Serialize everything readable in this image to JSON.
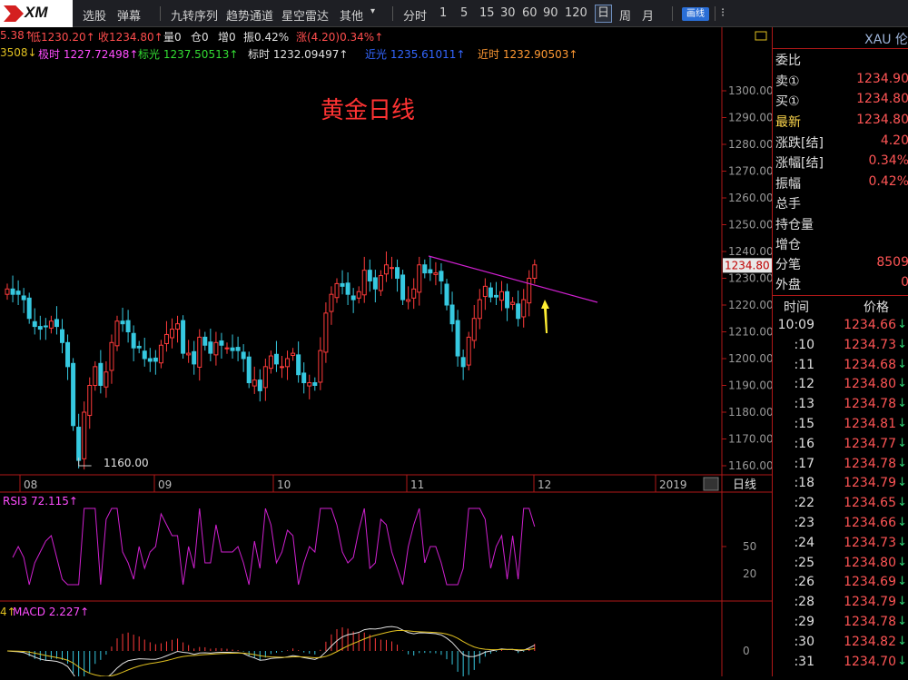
{
  "toolbar": {
    "logo": "XM",
    "items": [
      "选股",
      "弹幕",
      "九转序列",
      "趋势通道",
      "星空雷达",
      "其他",
      "分时",
      "1",
      "5",
      "15",
      "30",
      "60",
      "90",
      "120",
      "日",
      "周",
      "月"
    ],
    "other_arrow": "▾",
    "draw_button": "画线",
    "more": "⁝",
    "selected": "日"
  },
  "info_line1": [
    {
      "text": "5.38↑",
      "color": "#ff4d4d"
    },
    {
      "text": "低1230.20↑",
      "color": "#ff4d4d"
    },
    {
      "text": "收1234.80↑",
      "color": "#ff4d4d"
    },
    {
      "text": "量0",
      "color": "#e0e0e0"
    },
    {
      "text": "仓0",
      "color": "#e0e0e0"
    },
    {
      "text": "增0",
      "color": "#e0e0e0"
    },
    {
      "text": "振0.42%",
      "color": "#e0e0e0"
    },
    {
      "text": "涨(4.20)0.34%↑",
      "color": "#ff4d4d"
    }
  ],
  "info_line2": [
    {
      "text": "3508↓",
      "color": "#e0c020"
    },
    {
      "text": "极时 1227.72498↑",
      "color": "#ff4dff"
    },
    {
      "text": "标光 1237.50513↑",
      "color": "#33dd33"
    },
    {
      "text": "标时 1232.09497↑",
      "color": "#e0e0e0"
    },
    {
      "text": "近光 1235.61011↑",
      "color": "#3366ff"
    },
    {
      "text": "近时 1232.90503↑",
      "color": "#ff9933"
    }
  ],
  "chart_title": "黄金日线",
  "chart_data": {
    "type": "candlestick",
    "title": "黄金日线",
    "y_ticks": [
      "1300.00",
      "1290.00",
      "1280.00",
      "1270.00",
      "1260.00",
      "1250.00",
      "1240.00",
      "1230.00",
      "1220.00",
      "1210.00",
      "1200.00",
      "1190.00",
      "1180.00",
      "1170.00",
      "1160.00"
    ],
    "ylim": [
      1155,
      1305
    ],
    "current_price": "1234.80",
    "low_label": "1160.00",
    "x_labels": [
      "08",
      "09",
      "10",
      "11",
      "12",
      "2019"
    ],
    "period_label": "日线",
    "closes": [
      1226,
      1224,
      1224,
      1222,
      1215,
      1212,
      1211,
      1212,
      1214,
      1212,
      1206,
      1197,
      1175,
      1162,
      1180,
      1190,
      1197,
      1190,
      1195,
      1206,
      1214,
      1213,
      1210,
      1204,
      1204,
      1200,
      1199,
      1199,
      1205,
      1209,
      1211,
      1213,
      1202,
      1202,
      1198,
      1208,
      1205,
      1202,
      1206,
      1205,
      1204,
      1203,
      1203,
      1200,
      1191,
      1192,
      1188,
      1197,
      1201,
      1198,
      1197,
      1200,
      1202,
      1194,
      1191,
      1191,
      1190,
      1203,
      1217,
      1224,
      1228,
      1227,
      1224,
      1222,
      1225,
      1233,
      1229,
      1226,
      1231,
      1235,
      1234,
      1230,
      1222,
      1222,
      1226,
      1235,
      1232,
      1232,
      1232,
      1229,
      1220,
      1213,
      1201,
      1197,
      1208,
      1215,
      1222,
      1227,
      1223,
      1223,
      1225,
      1219,
      1221,
      1215,
      1222,
      1230,
      1235
    ],
    "rsi": {
      "label": "RSI3 72.115↑",
      "ticks": [
        "50",
        "20"
      ]
    },
    "macd": {
      "label": "MACD 2.227↑",
      "prefix": "4↑",
      "ticks": [
        "0"
      ]
    }
  },
  "side": {
    "symbol": "XAU 伦",
    "rows": [
      {
        "label": "委比",
        "value": ""
      },
      {
        "label": "卖①",
        "value": "1234.90"
      },
      {
        "label": "买①",
        "value": "1234.80"
      },
      {
        "label": "最新",
        "value": "1234.80"
      },
      {
        "label": "涨跌[结]",
        "value": "4.20"
      },
      {
        "label": "涨幅[结]",
        "value": "0.34%"
      },
      {
        "label": "振幅",
        "value": "0.42%"
      },
      {
        "label": "总手",
        "value": ""
      },
      {
        "label": "持仓量",
        "value": ""
      },
      {
        "label": "增仓",
        "value": ""
      },
      {
        "label": "分笔",
        "value": "8509"
      },
      {
        "label": "外盘",
        "value": "0"
      }
    ],
    "tick_header": {
      "time": "时间",
      "price": "价格"
    },
    "ticks": [
      {
        "t": "10:09",
        "p": "1234.66"
      },
      {
        "t": ":10",
        "p": "1234.73"
      },
      {
        "t": ":11",
        "p": "1234.68"
      },
      {
        "t": ":12",
        "p": "1234.80"
      },
      {
        "t": ":13",
        "p": "1234.78"
      },
      {
        "t": ":15",
        "p": "1234.81"
      },
      {
        "t": ":16",
        "p": "1234.77"
      },
      {
        "t": ":17",
        "p": "1234.78"
      },
      {
        "t": ":18",
        "p": "1234.79"
      },
      {
        "t": ":22",
        "p": "1234.65"
      },
      {
        "t": ":23",
        "p": "1234.66"
      },
      {
        "t": ":24",
        "p": "1234.73"
      },
      {
        "t": ":25",
        "p": "1234.80"
      },
      {
        "t": ":26",
        "p": "1234.69"
      },
      {
        "t": ":28",
        "p": "1234.79"
      },
      {
        "t": ":29",
        "p": "1234.78"
      },
      {
        "t": ":30",
        "p": "1234.82"
      },
      {
        "t": ":31",
        "p": "1234.70"
      }
    ],
    "arrow": "↓"
  }
}
